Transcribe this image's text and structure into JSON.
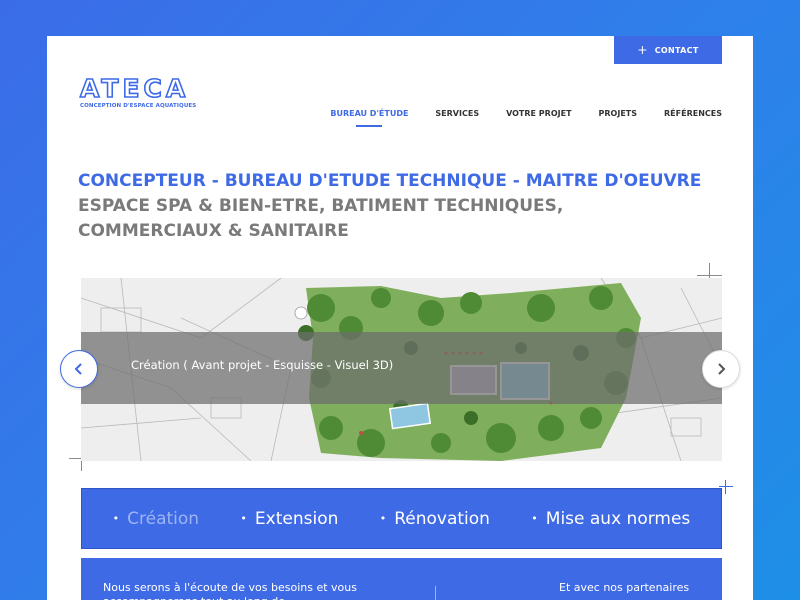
{
  "header": {
    "contact_label": "CONTACT",
    "logo_word": "ATECA",
    "logo_tagline": "CONCEPTION D'ESPACE AQUATIQUES"
  },
  "nav": {
    "items": [
      {
        "label": "BUREAU D'ÉTUDE"
      },
      {
        "label": "SERVICES"
      },
      {
        "label": "VOTRE PROJET"
      },
      {
        "label": "PROJETS"
      },
      {
        "label": "RÉFÉRENCES"
      }
    ]
  },
  "headline": {
    "line1": "CONCEPTEUR - BUREAU D'ETUDE TECHNIQUE - MAITRE D'OEUVRE",
    "line2": "ESPACE SPA & BIEN-ETRE, BATIMENT TECHNIQUES,",
    "line3": "COMMERCIAUX & SANITAIRE"
  },
  "slider": {
    "caption": "Création ( Avant projet - Esquisse - Visuel 3D)",
    "prev_icon": "chevron-left-icon",
    "next_icon": "chevron-right-icon"
  },
  "services": {
    "items": [
      {
        "label": "Création"
      },
      {
        "label": "Extension"
      },
      {
        "label": "Rénovation"
      },
      {
        "label": "Mise aux normes"
      }
    ]
  },
  "bottom": {
    "left_text": "Nous serons à l'écoute de vos besoins et vous accompagnerons tout au long de",
    "right_text": "Et avec nos partenaires"
  },
  "colors": {
    "accent": "#3f6ae6",
    "heading_grey": "#7a7a7a",
    "background_gradient_start": "#3b6ce8",
    "background_gradient_end": "#1e8fe6"
  }
}
